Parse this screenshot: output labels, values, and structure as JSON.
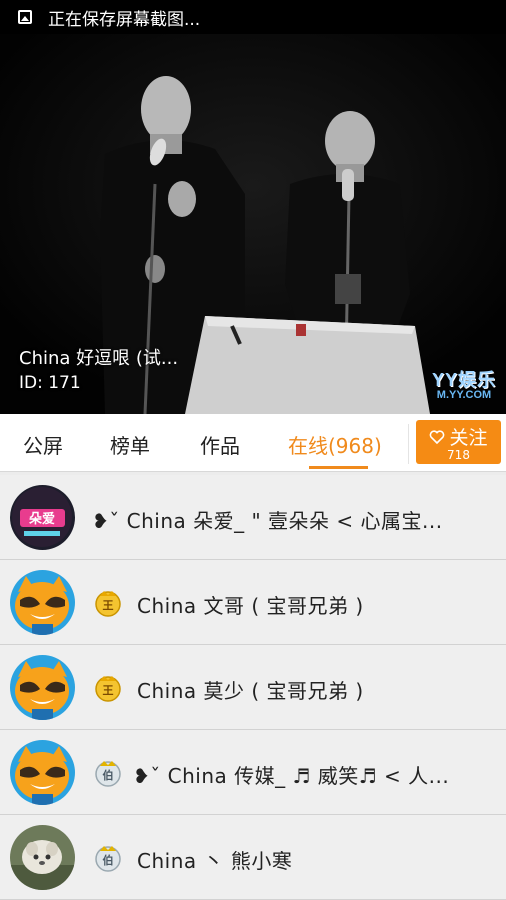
{
  "status_bar": {
    "icon": "image-icon",
    "text": "正在保存屏幕截图..."
  },
  "video": {
    "title": "China 好逗哏 (试...",
    "id_text": "ID: 171",
    "watermark": {
      "top": "YY",
      "top_cn": "娱乐",
      "sub": "M.YY.COM"
    }
  },
  "tabs": [
    {
      "label": "公屏",
      "active": false
    },
    {
      "label": "榜单",
      "active": false
    },
    {
      "label": "作品",
      "active": false
    },
    {
      "label": "在线(968)",
      "active": true
    }
  ],
  "follow_button": {
    "label": "关注",
    "count": "718",
    "icon": "heart-icon"
  },
  "colors": {
    "accent": "#f08a1c",
    "button_bg": "#f58b14",
    "row_bg": "#efefef"
  },
  "online_users": [
    {
      "name": "❥ˇ China 朵爱_ \" 壹朵朵 < 心属宝...",
      "avatar": "custom-avatar-pink",
      "badge": null
    },
    {
      "name": "China 文哥 ( 宝哥兄弟 )",
      "avatar": "yy-raccoon-avatar",
      "badge": "king-badge"
    },
    {
      "name": "China 莫少 ( 宝哥兄弟 )",
      "avatar": "yy-raccoon-avatar",
      "badge": "king-badge"
    },
    {
      "name": "❥ˇ China 传媒_ ♬ 威笑♬ < 人...",
      "avatar": "yy-raccoon-avatar",
      "badge": "earl-badge"
    },
    {
      "name": "China 丶 熊小寒",
      "avatar": "photo-avatar",
      "badge": "earl-badge"
    }
  ]
}
